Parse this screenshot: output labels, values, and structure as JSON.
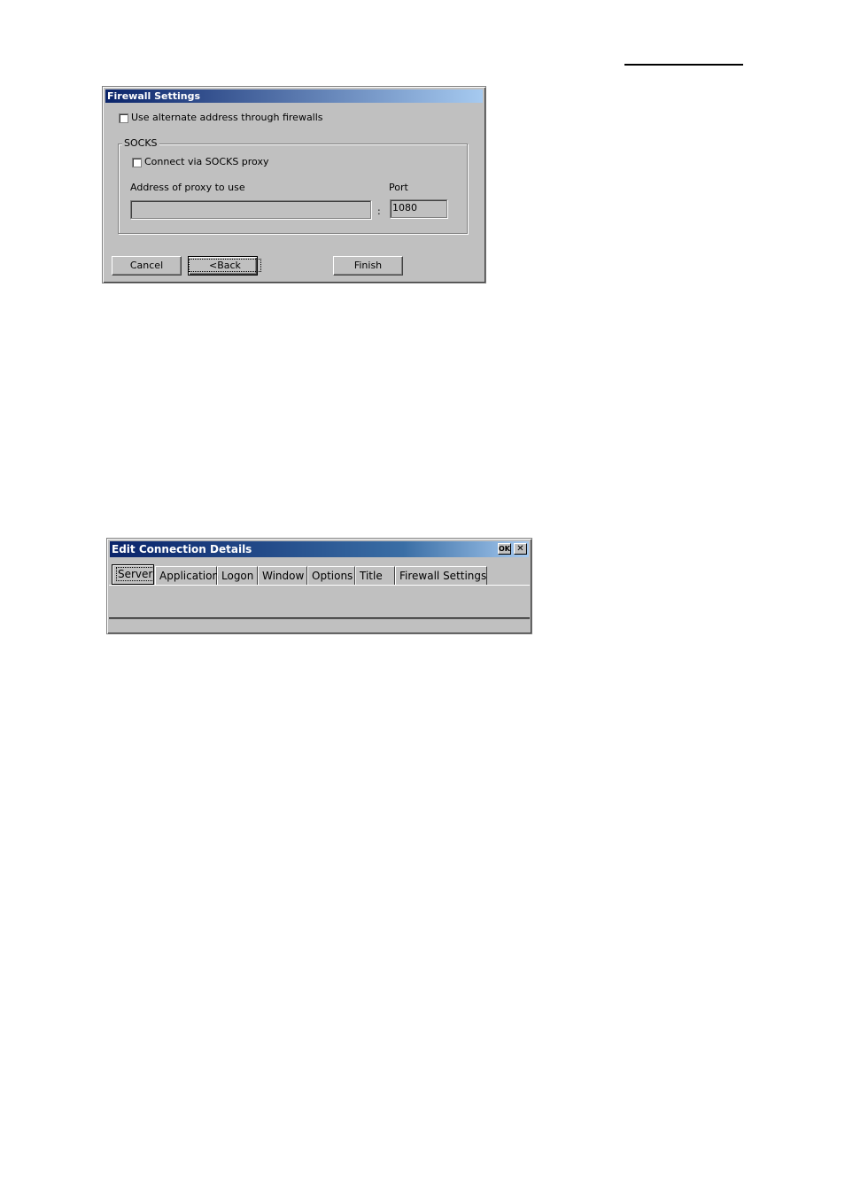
{
  "firewall_dialog": {
    "title": "Firewall Settings",
    "use_alternate_label": "Use alternate address through firewalls",
    "use_alternate_checked": false,
    "socks_group_label": "SOCKS",
    "connect_socks_label": "Connect via SOCKS proxy",
    "connect_socks_checked": false,
    "proxy_address_label": "Address of proxy to use",
    "proxy_address_value": "",
    "port_separator": ":",
    "port_label": "Port",
    "port_value": "1080",
    "cancel_label": "Cancel",
    "back_label": "<Back",
    "finish_label": "Finish"
  },
  "edit_dialog": {
    "title": "Edit Connection Details",
    "ok_label": "OK",
    "close_label": "✕",
    "tabs": [
      {
        "label": "Server"
      },
      {
        "label": "Application"
      },
      {
        "label": "Logon"
      },
      {
        "label": "Window"
      },
      {
        "label": "Options"
      },
      {
        "label": "Title"
      },
      {
        "label": "Firewall Settings"
      }
    ],
    "active_tab": "Server"
  }
}
